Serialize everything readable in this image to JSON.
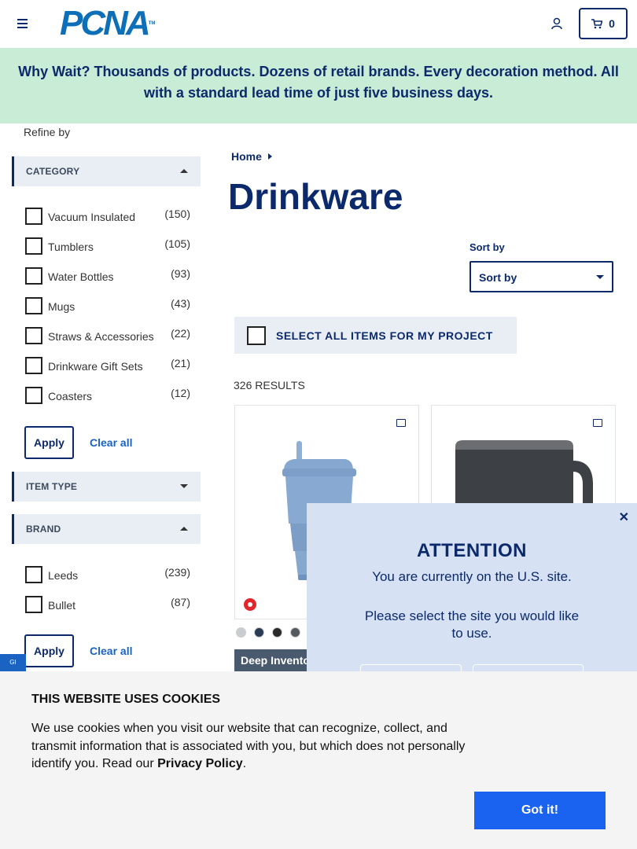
{
  "header": {
    "logo_text": "PCNA",
    "logo_tm": "TM",
    "cart_count": "0"
  },
  "banner": {
    "text": "Why Wait? Thousands of products. Dozens of retail brands. Every decoration method. All with a standard lead time of just five business days."
  },
  "sidebar": {
    "refine_label": "Refine by",
    "category": {
      "heading": "CATEGORY",
      "options": [
        {
          "label": "Vacuum Insulated",
          "count": "(150)"
        },
        {
          "label": "Tumblers",
          "count": "(105)"
        },
        {
          "label": "Water Bottles",
          "count": "(93)"
        },
        {
          "label": "Mugs",
          "count": "(43)"
        },
        {
          "label": "Straws & Accessories",
          "count": "(22)"
        },
        {
          "label": "Drinkware Gift Sets",
          "count": "(21)"
        },
        {
          "label": "Coasters",
          "count": "(12)"
        }
      ],
      "apply": "Apply",
      "clear": "Clear all"
    },
    "item_type": {
      "heading": "ITEM TYPE"
    },
    "brand": {
      "heading": "BRAND",
      "options": [
        {
          "label": "Leeds",
          "count": "(239)"
        },
        {
          "label": "Bullet",
          "count": "(87)"
        }
      ],
      "apply": "Apply",
      "clear": "Clear all"
    }
  },
  "main": {
    "breadcrumb": "Home",
    "title": "Drinkware",
    "sort_label": "Sort by",
    "sort_value": "Sort by",
    "select_all": "SELECT ALL ITEMS FOR MY PROJECT",
    "results": "326 RESULTS",
    "badge": "Deep Inventory",
    "swatch_colors": [
      "#c9ccd0",
      "#2b3a55",
      "#2a2a2a",
      "#555a60"
    ]
  },
  "modal": {
    "title": "ATTENTION",
    "line1": "You are currently on the U.S. site.",
    "line2": "Please select the site you would like to use.",
    "close": "✕"
  },
  "feedback_tab": "GI",
  "cookie": {
    "title": "THIS WEBSITE USES COOKIES",
    "body": "We use cookies when you visit our website that can recognize, collect, and transmit information that is associated with you, but which does not personally identify you. Read our ",
    "link": "Privacy Policy",
    "end": ".",
    "button": "Got it!"
  },
  "colors": {
    "brand_navy": "#0c2a6b",
    "banner_bg": "#c8ecd6",
    "modal_bg": "#d6e1f3",
    "cookie_button": "#1a63f0"
  }
}
